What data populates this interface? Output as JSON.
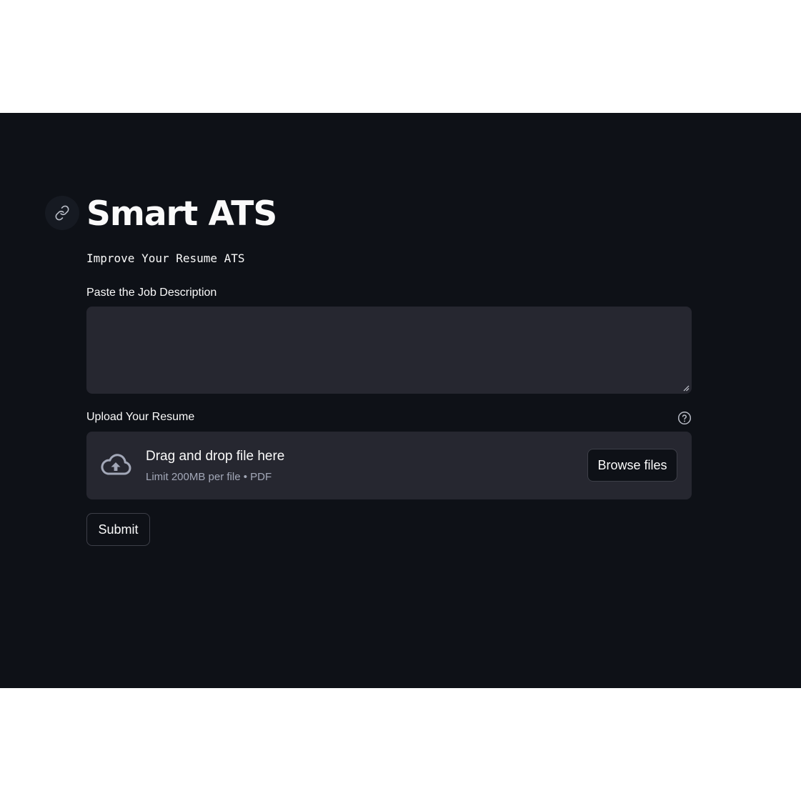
{
  "header": {
    "title": "Smart ATS",
    "subtitle": "Improve Your Resume ATS"
  },
  "job_description": {
    "label": "Paste the Job Description",
    "value": "",
    "placeholder": ""
  },
  "resume_upload": {
    "label": "Upload Your Resume",
    "dropzone_title": "Drag and drop file here",
    "dropzone_limit": "Limit 200MB per file • PDF",
    "browse_label": "Browse files"
  },
  "actions": {
    "submit_label": "Submit"
  },
  "icons": {
    "anchor": "link-icon",
    "help": "question-circle-icon",
    "upload": "cloud-upload-icon",
    "resize": "resize-handle-icon"
  },
  "colors": {
    "background": "#0e1117",
    "widget": "#262730",
    "text": "#fafafa",
    "muted_text": "#a3a8b8",
    "border": "#3d3f48"
  }
}
